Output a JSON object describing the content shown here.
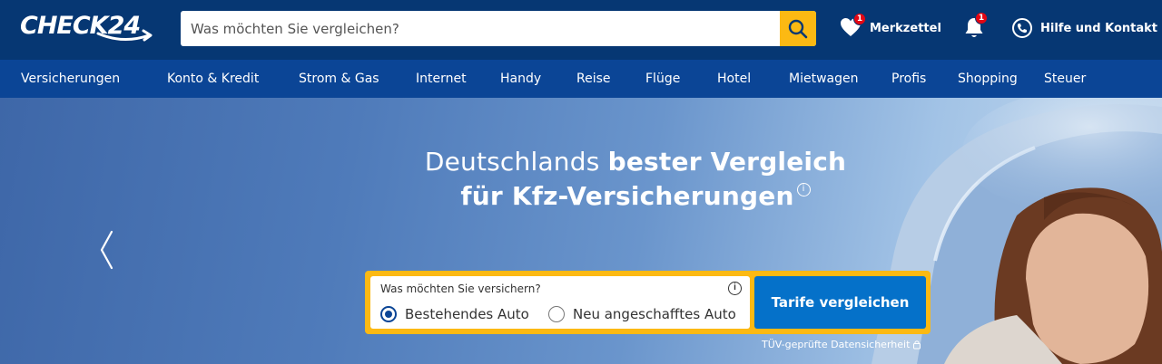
{
  "header": {
    "logo": "CHECK24",
    "search_placeholder": "Was möchten Sie vergleichen?",
    "merkzettel_label": "Merkzettel",
    "merkzettel_count": "1",
    "notifications_count": "1",
    "help_label": "Hilfe und Kontakt"
  },
  "nav": {
    "items": [
      "Versicherungen",
      "Konto & Kredit",
      "Strom & Gas",
      "Internet",
      "Handy",
      "Reise",
      "Flüge",
      "Hotel",
      "Mietwagen",
      "Profis",
      "Shopping",
      "Steuer"
    ]
  },
  "hero": {
    "title_light": "Deutschlands",
    "title_bold_1": "bester Vergleich",
    "title_bold_2": "für Kfz-Versicherungen",
    "info_glyph": "i"
  },
  "form": {
    "question": "Was möchten Sie versichern?",
    "info_glyph": "i",
    "options": [
      {
        "label": "Bestehendes Auto",
        "selected": true
      },
      {
        "label": "Neu angeschafftes Auto",
        "selected": false
      }
    ],
    "cta_label": "Tarife vergleichen"
  },
  "trust": {
    "label": "TÜV-geprüfte Datensicherheit"
  },
  "colors": {
    "header_bg": "#063773",
    "nav_bg": "#0b4596",
    "accent_yellow": "#fcb913",
    "cta_blue": "#0571c9",
    "badge_red": "#e30613"
  },
  "icons": [
    "search-icon",
    "heart-icon",
    "bell-icon",
    "phone-icon",
    "chevron-left-icon",
    "info-icon",
    "lock-icon"
  ]
}
